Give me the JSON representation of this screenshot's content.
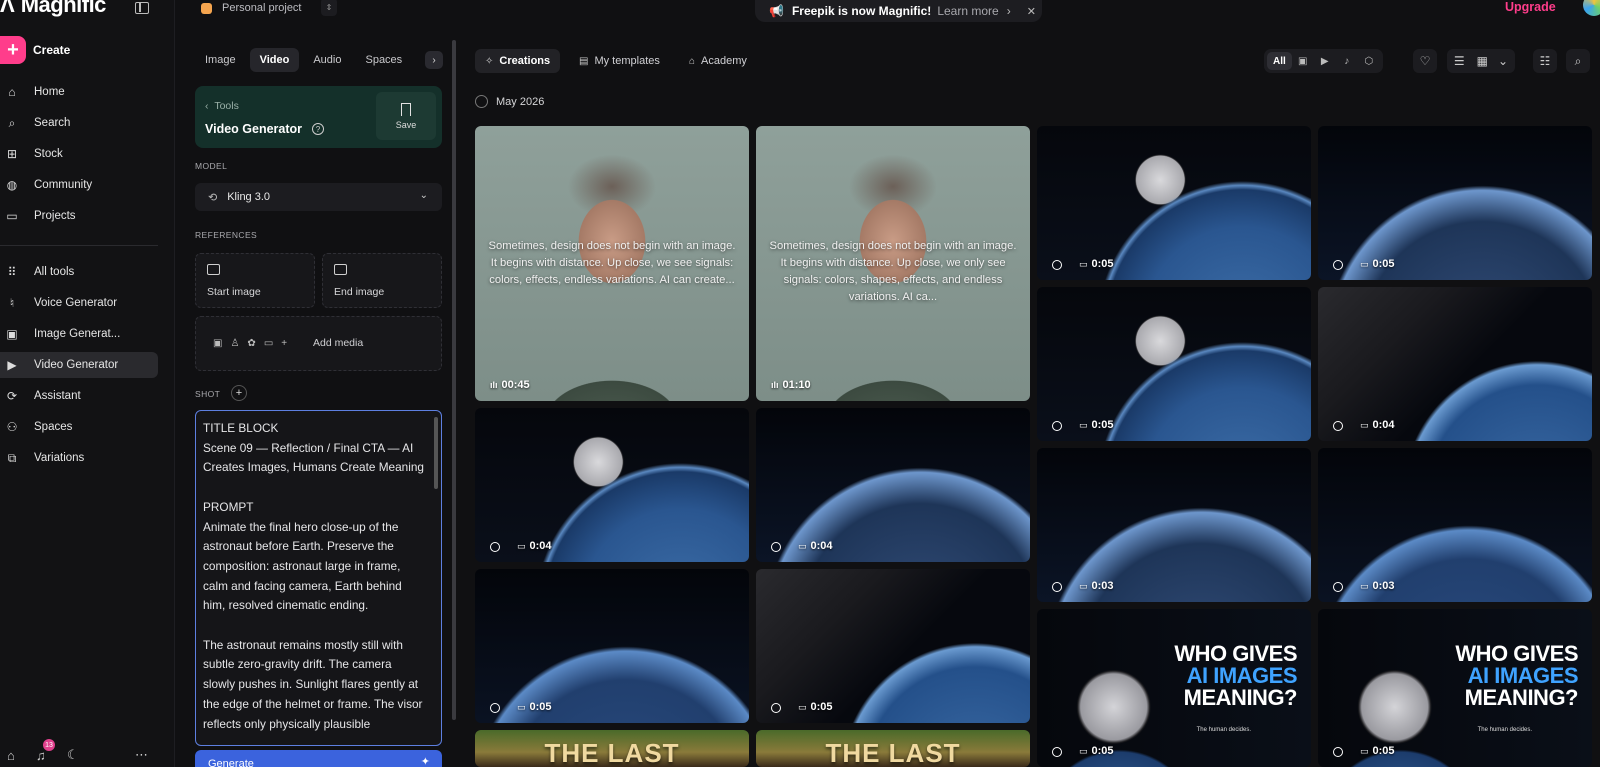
{
  "app": {
    "brand": "Magnific"
  },
  "nav": {
    "create_label": "Create",
    "items": [
      {
        "label": "Home",
        "icon": "home-icon"
      },
      {
        "label": "Search",
        "icon": "search-icon"
      },
      {
        "label": "Stock",
        "icon": "stock-icon"
      },
      {
        "label": "Community",
        "icon": "globe-icon"
      },
      {
        "label": "Projects",
        "icon": "folder-icon"
      },
      {
        "label": "All tools",
        "icon": "grid-icon"
      },
      {
        "label": "Voice Generator",
        "icon": "mic-icon"
      },
      {
        "label": "Image Generat...",
        "icon": "image-icon"
      },
      {
        "label": "Video Generator",
        "icon": "video-icon"
      },
      {
        "label": "Assistant",
        "icon": "assistant-icon"
      },
      {
        "label": "Spaces",
        "icon": "spaces-icon"
      },
      {
        "label": "Variations",
        "icon": "variations-icon"
      }
    ],
    "active_item": "Video Generator",
    "notification_count": "13"
  },
  "project": {
    "name": "Personal project"
  },
  "panel": {
    "tabs": [
      "Image",
      "Video",
      "Audio",
      "Spaces"
    ],
    "active_tab": "Video",
    "tool_back": "Tools",
    "tool_title": "Video Generator",
    "save_label": "Save",
    "model_label": "MODEL",
    "model_value": "Kling 3.0",
    "references_label": "REFERENCES",
    "start_image": "Start image",
    "end_image": "End image",
    "add_media": "Add media",
    "shot_label": "SHOT",
    "prompt_text": "TITLE BLOCK\nScene 09 — Reflection / Final CTA — AI Creates Images, Humans Create Meaning\n\nPROMPT\nAnimate the final hero close-up of the astronaut before Earth. Preserve the composition: astronaut large in frame, calm and facing camera, Earth behind him, resolved cinematic ending.\n\nThe astronaut remains mostly still with subtle zero-gravity drift. The camera slowly pushes in. Sunlight flares gently at the edge of the helmet or frame. The visor reflects only physically plausible",
    "generate_label": "Generate"
  },
  "banner": {
    "text": "Freepik is now Magnific!",
    "link": "Learn more"
  },
  "upgrade_label": "Upgrade",
  "gallery": {
    "tabs": [
      "Creations",
      "My templates",
      "Academy"
    ],
    "active_tab": "Creations",
    "filters": [
      "All",
      "image",
      "video",
      "audio",
      "3d"
    ],
    "active_filter": "All",
    "date_group": "May 2026",
    "tiles": [
      {
        "duration": "00:45",
        "kind": "audio",
        "overlay": "Sometimes, design does not begin with an image. It begins with distance. Up close, we see signals: colors, effects, endless variations. AI can create..."
      },
      {
        "duration": "01:10",
        "kind": "audio",
        "overlay": "Sometimes, design does not begin with an image. It begins with distance. Up close, we only see signals: colors, shapes, effects, and endless variations. AI ca..."
      },
      {
        "duration": "0:05",
        "kind": "video"
      },
      {
        "duration": "0:05",
        "kind": "video"
      },
      {
        "duration": "0:05",
        "kind": "video"
      },
      {
        "duration": "0:04",
        "kind": "video"
      },
      {
        "duration": "0:04",
        "kind": "video"
      },
      {
        "duration": "0:04",
        "kind": "video"
      },
      {
        "duration": "0:03",
        "kind": "video"
      },
      {
        "duration": "0:03",
        "kind": "video"
      },
      {
        "duration": "0:05",
        "kind": "video"
      },
      {
        "duration": "0:05",
        "kind": "video"
      },
      {
        "duration": "0:05",
        "kind": "video",
        "poster": [
          "WHO GIVES",
          "AI IMAGES",
          "MEANING?"
        ],
        "poster_sub": "The human decides."
      },
      {
        "duration": "0:05",
        "kind": "video",
        "poster": [
          "WHO GIVES",
          "AI IMAGES",
          "MEANING?"
        ],
        "poster_sub": "The human decides."
      },
      {
        "title": "THE LAST"
      },
      {
        "title": "THE LAST"
      }
    ]
  },
  "colors": {
    "accent_pink": "#ff3d8b",
    "accent_blue": "#3b63dd",
    "poster_blue": "#3fa3ff"
  }
}
